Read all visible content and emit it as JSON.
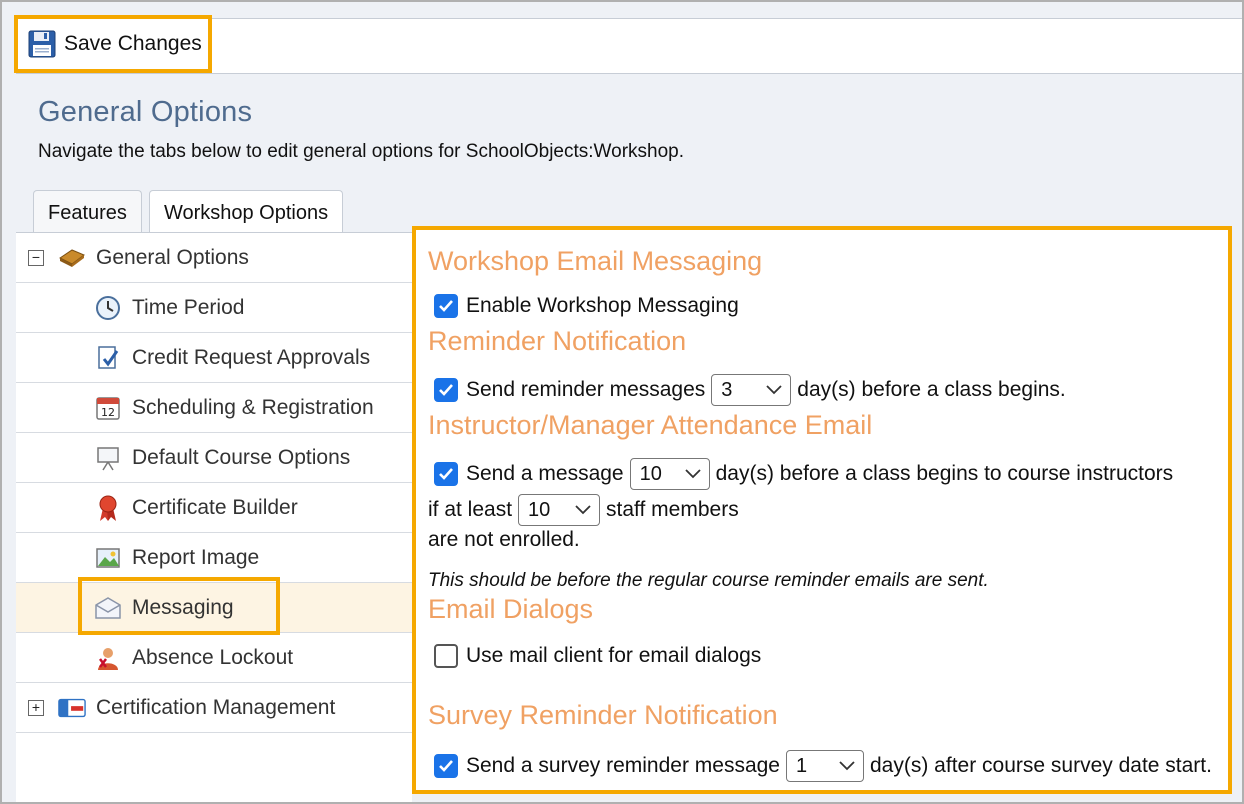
{
  "toolbar": {
    "save_label": "Save Changes"
  },
  "header": {
    "title": "General Options",
    "description": "Navigate the tabs below to edit general options for SchoolObjects:Workshop."
  },
  "tabs": [
    {
      "label": "Features",
      "active": false
    },
    {
      "label": "Workshop Options",
      "active": true
    }
  ],
  "tree": {
    "root1": {
      "label": "General Options",
      "toggle": "−",
      "icon": "book-icon"
    },
    "items": [
      {
        "label": "Time Period",
        "icon": "clock-icon"
      },
      {
        "label": "Credit Request Approvals",
        "icon": "approval-document-icon"
      },
      {
        "label": "Scheduling & Registration",
        "icon": "calendar-icon"
      },
      {
        "label": "Default Course Options",
        "icon": "presentation-board-icon"
      },
      {
        "label": "Certificate Builder",
        "icon": "ribbon-award-icon"
      },
      {
        "label": "Report Image",
        "icon": "image-icon"
      },
      {
        "label": "Messaging",
        "icon": "envelope-icon",
        "selected": true
      },
      {
        "label": "Absence Lockout",
        "icon": "user-blocked-icon"
      }
    ],
    "root2": {
      "label": "Certification Management",
      "toggle": "+",
      "icon": "id-card-icon"
    },
    "calendar_number": "12"
  },
  "panel": {
    "workshop_email": {
      "title": "Workshop Email Messaging",
      "enable_label": "Enable Workshop Messaging",
      "enabled": true
    },
    "reminder": {
      "title": "Reminder Notification",
      "text_before": "Send reminder messages",
      "days_value": "3",
      "text_after": "day(s) before a class begins.",
      "checked": true
    },
    "attendance": {
      "title": "Instructor/Manager Attendance Email",
      "text_before": "Send a message",
      "days_value": "10",
      "text_after": "day(s) before a class begins to course instructors",
      "line2_before": "if at least",
      "staff_value": "10",
      "line2_after": "staff members",
      "line3": "are not enrolled.",
      "note": "This should be before the regular course reminder emails are sent.",
      "checked": true
    },
    "email_dialogs": {
      "title": "Email Dialogs",
      "label": "Use mail client for email dialogs",
      "checked": false
    },
    "survey": {
      "title": "Survey Reminder Notification",
      "text_before": "Send a survey reminder message",
      "days_value": "1",
      "text_after": "day(s) after course survey date start.",
      "checked": true
    }
  },
  "colors": {
    "highlight": "#f5a800",
    "section_title": "#f0a163",
    "page_title": "#4f6b8e",
    "checkbox": "#1a73e8"
  }
}
